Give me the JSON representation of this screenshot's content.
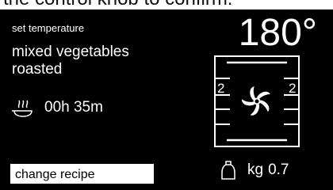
{
  "caption": {
    "text": "the control knob to confirm."
  },
  "display": {
    "set_temperature_label": "set temperature",
    "recipe_name": "mixed vegetables roasted",
    "temperature": "180°",
    "cooking_time": "00h 35m",
    "rack_level_left": "2",
    "rack_level_right": "2",
    "change_recipe_label": "change recipe",
    "weight_unit": "kg",
    "weight_value": "0.7"
  },
  "icons": {
    "steam": "steam-dish-icon",
    "fan": "convection-fan-icon",
    "weight": "weight-icon"
  },
  "colors": {
    "screen_background": "#000000",
    "screen_text": "#ffffff",
    "button_background": "#ffffff",
    "button_text": "#000000"
  }
}
